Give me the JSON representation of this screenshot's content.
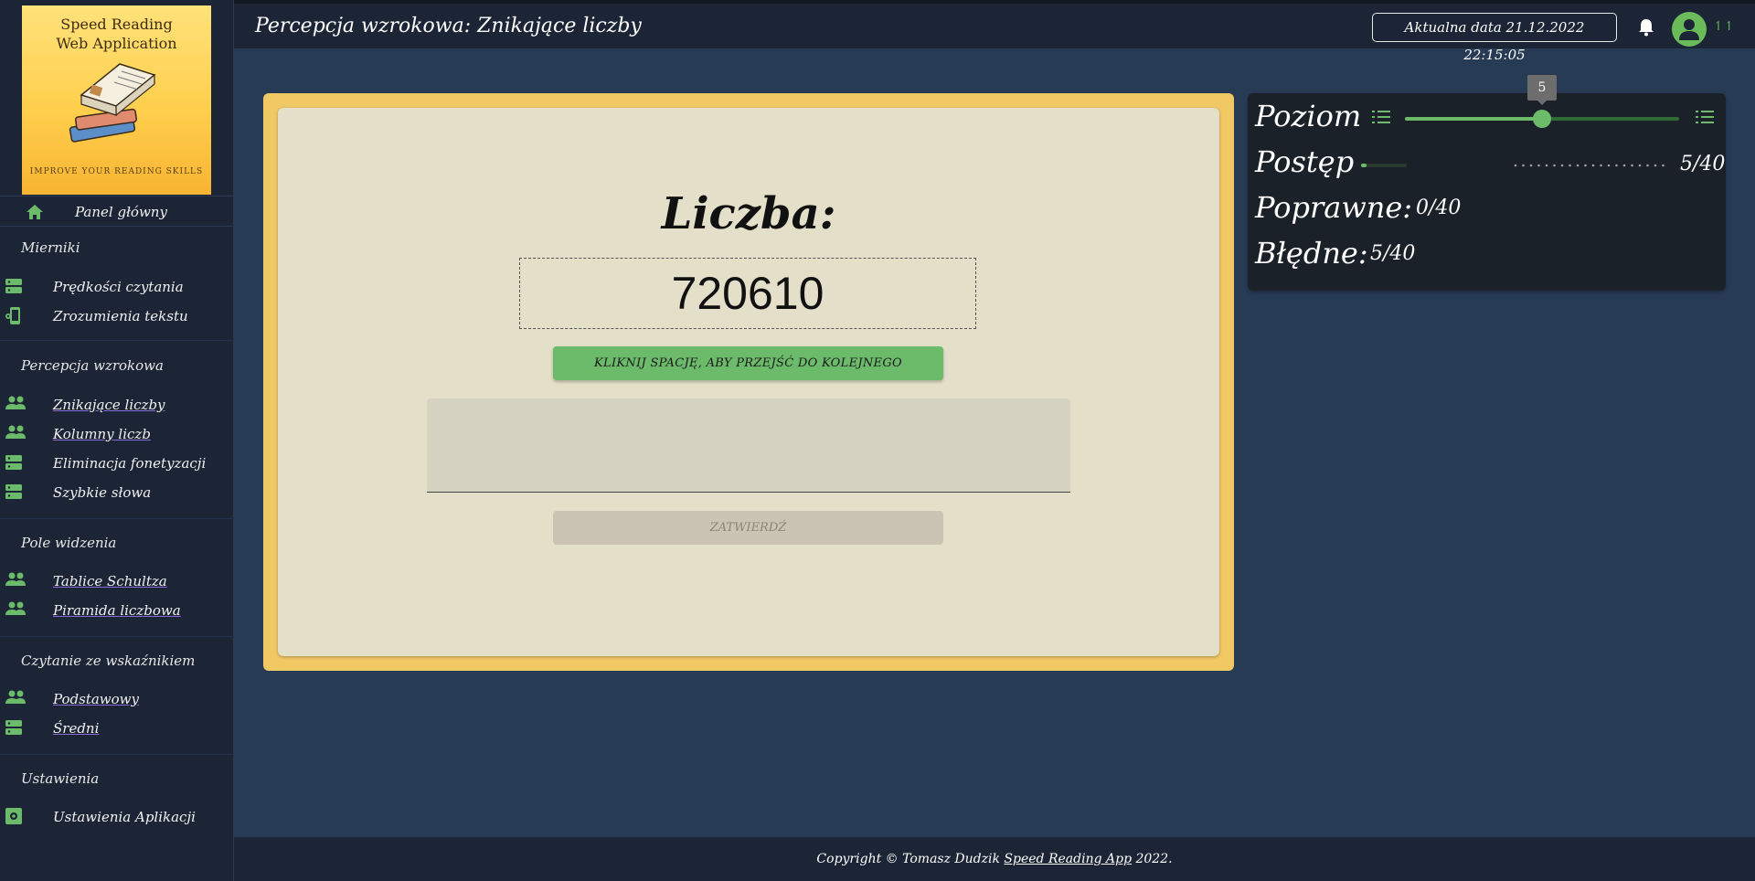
{
  "logo": {
    "title_line1": "Speed Reading",
    "title_line2": "Web Application",
    "tagline": "IMPROVE YOUR READING SKILLS"
  },
  "header": {
    "title": "Percepcja wzrokowa: Znikające liczby",
    "date": "Aktualna data 21.12.2022 22:15:05",
    "user_ticks": "↿↿"
  },
  "sidebar": {
    "home": "Panel główny",
    "sections": [
      {
        "title": "Mierniki",
        "items": [
          "Prędkości czytania",
          "Zrozumienia tekstu"
        ]
      },
      {
        "title": "Percepcja wzrokowa",
        "items": [
          "Znikające liczby",
          "Kolumny liczb",
          "Eliminacja fonetyzacji",
          "Szybkie słowa"
        ]
      },
      {
        "title": "Pole widzenia",
        "items": [
          "Tablice Schultza",
          "Piramida liczbowa"
        ]
      },
      {
        "title": "Czytanie ze wskaźnikiem",
        "items": [
          "Podstawowy",
          "Średni"
        ]
      },
      {
        "title": "Ustawienia",
        "items": [
          "Ustawienia Aplikacji"
        ]
      }
    ]
  },
  "exercise": {
    "label": "Liczba:",
    "number": "720610",
    "next_button": "KLIKNIJ SPACJĘ, ABY PRZEJŚĆ DO KOLEJNEGO",
    "answer_value": "",
    "submit_button": "ZATWIERDŹ"
  },
  "stats": {
    "level_label": "Poziom",
    "level_value": "5",
    "level_fraction": 0.5,
    "progress_label": "Postęp",
    "progress_value": "5/40",
    "progress_fraction": 0.125,
    "correct_label": "Poprawne:",
    "correct_value": "0/40",
    "wrong_label": "Błędne:",
    "wrong_value": "5/40"
  },
  "footer": {
    "prefix": "Copyright © Tomasz Dudzik ",
    "link": "Speed Reading App",
    "suffix": " 2022."
  },
  "colors": {
    "accent": "#6cbb6b",
    "card_frame": "#f0c965",
    "background": "#283b55",
    "sidebar": "#1b2535"
  }
}
